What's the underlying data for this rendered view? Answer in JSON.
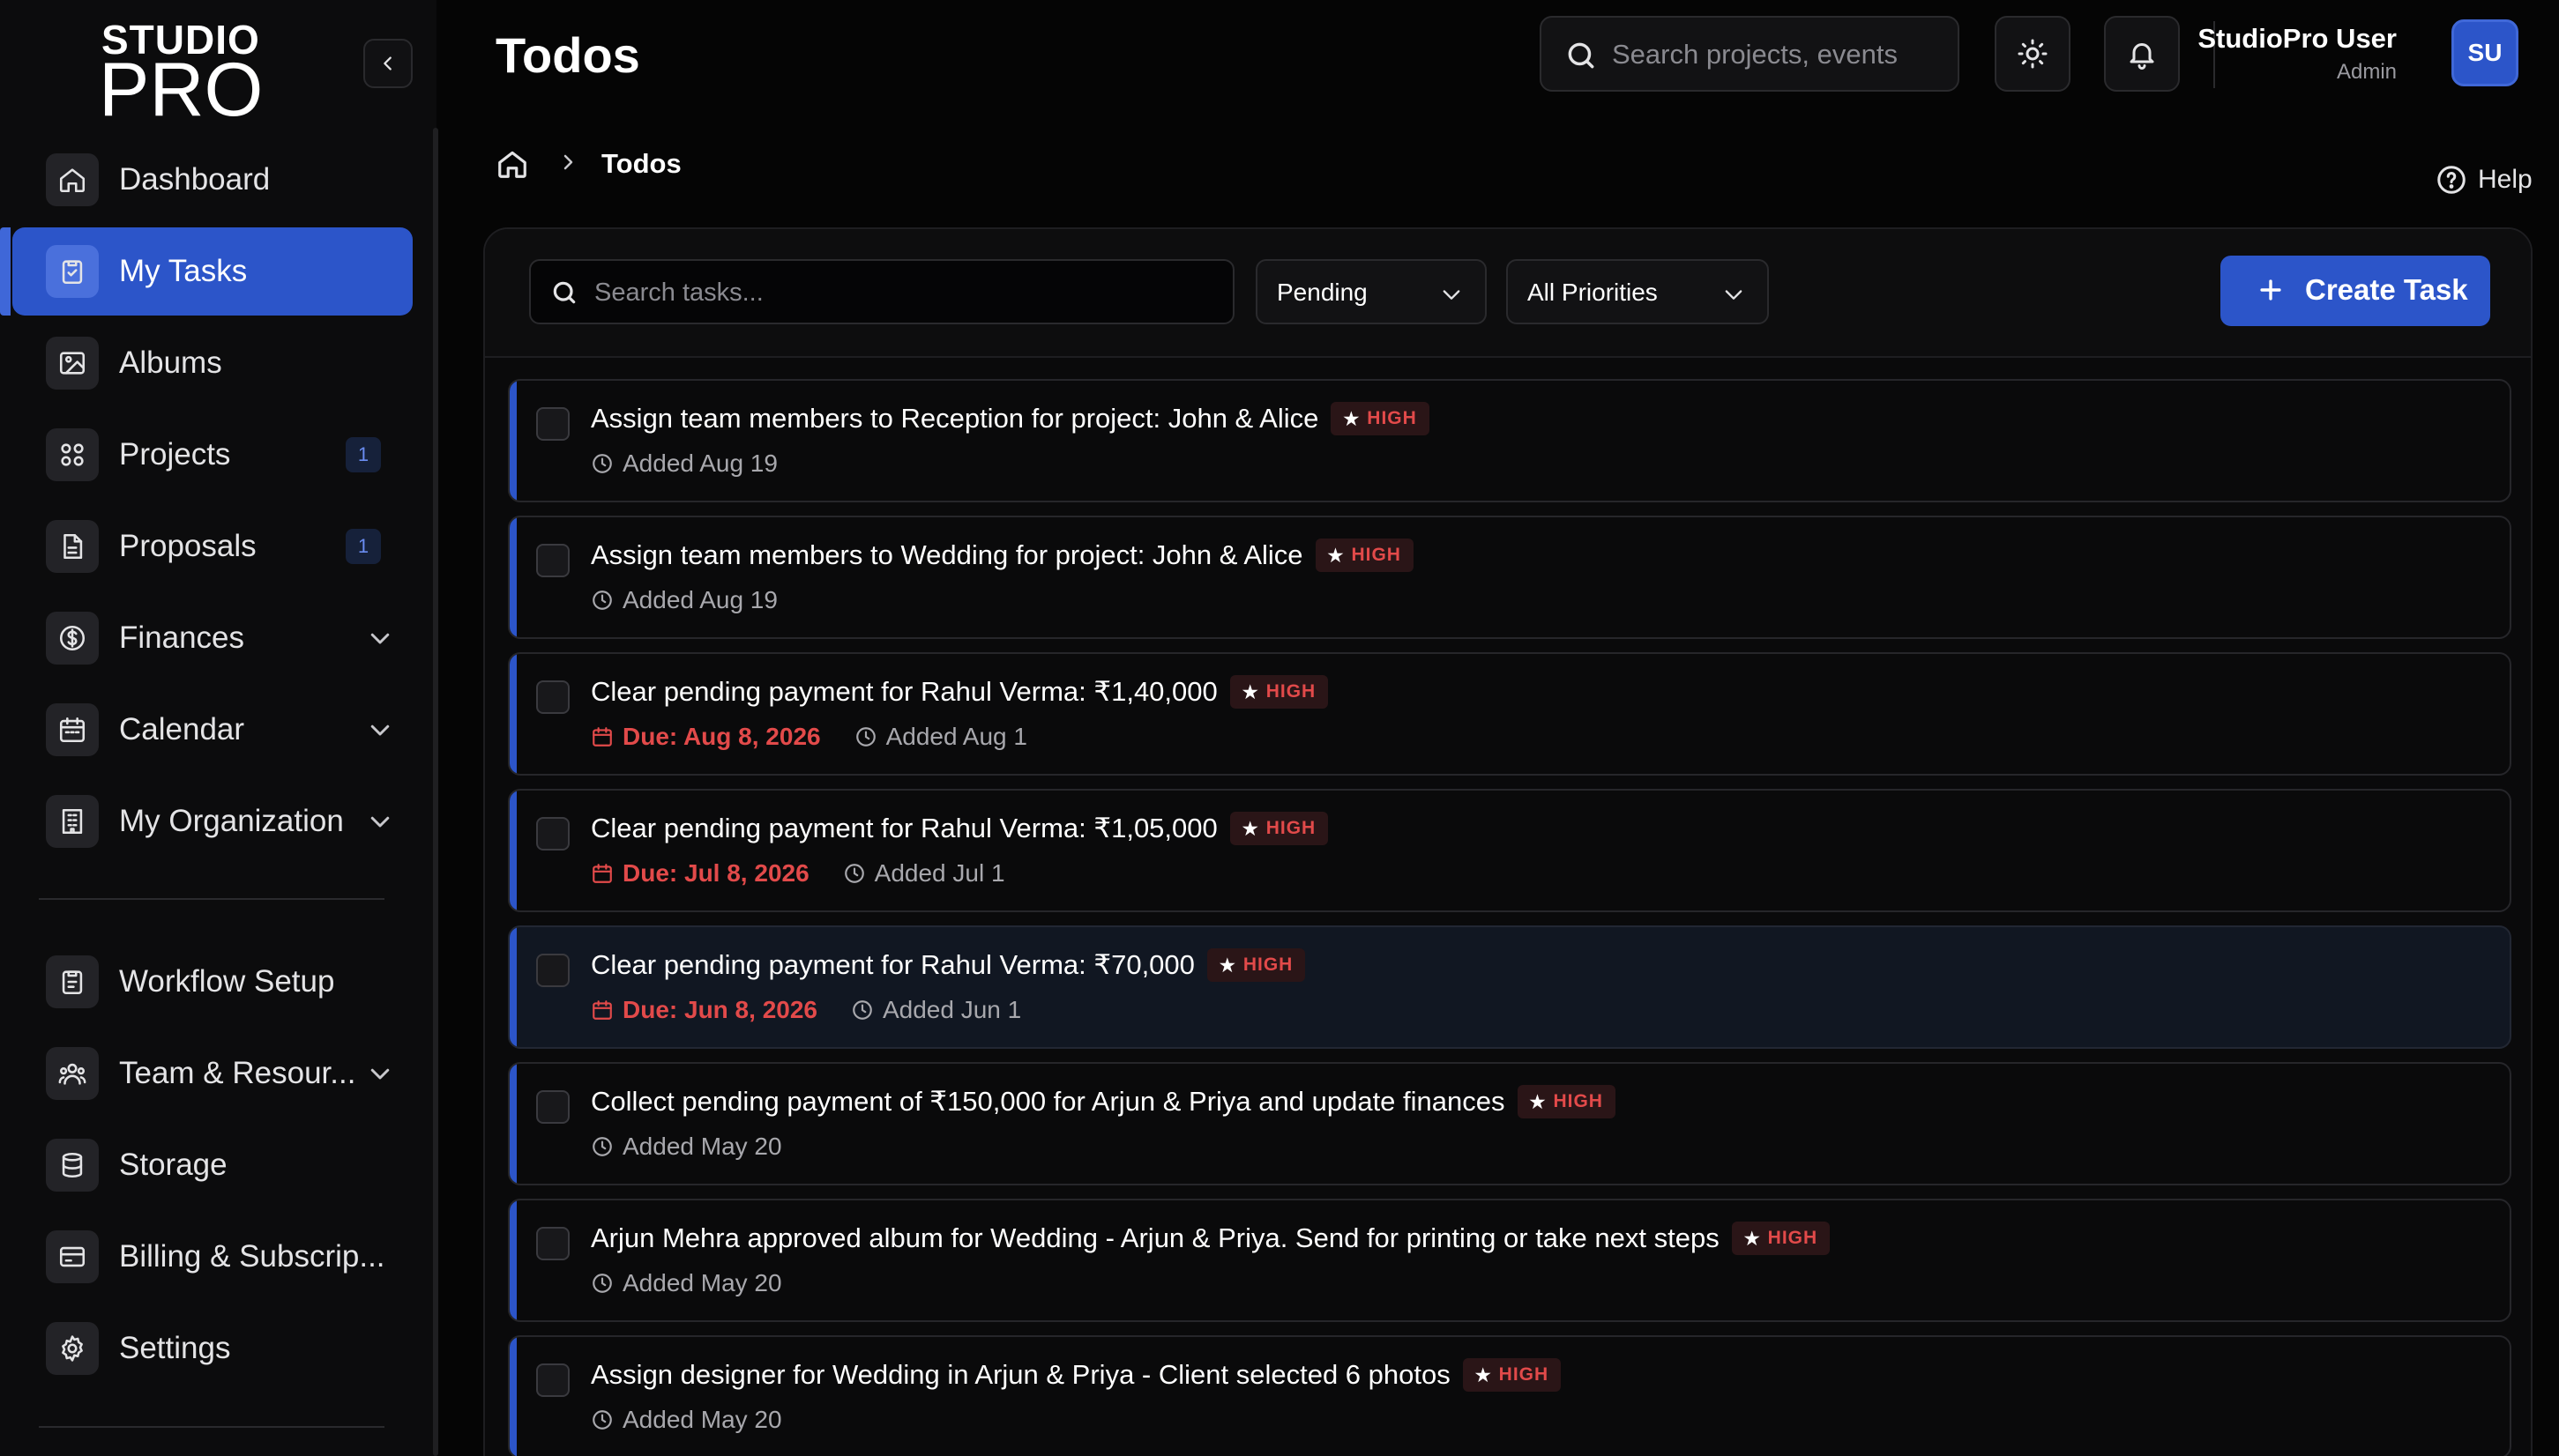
{
  "logo": {
    "top": "STUDIO",
    "bottom": "PRO"
  },
  "sidebar": {
    "items": [
      {
        "label": "Dashboard",
        "icon": "home-icon"
      },
      {
        "label": "My Tasks",
        "icon": "clipboard-check-icon",
        "active": true
      },
      {
        "label": "Albums",
        "icon": "image-icon"
      },
      {
        "label": "Projects",
        "icon": "grid-icon",
        "badge": "1"
      },
      {
        "label": "Proposals",
        "icon": "document-icon",
        "badge": "1"
      },
      {
        "label": "Finances",
        "icon": "dollar-icon",
        "expandable": true
      },
      {
        "label": "Calendar",
        "icon": "calendar-icon",
        "expandable": true
      },
      {
        "label": "My Organization",
        "icon": "building-icon",
        "expandable": true
      }
    ],
    "secondary_items": [
      {
        "label": "Workflow Setup",
        "icon": "clipboard-list-icon"
      },
      {
        "label": "Team & Resour...",
        "icon": "users-icon",
        "expandable": true
      },
      {
        "label": "Storage",
        "icon": "database-icon"
      },
      {
        "label": "Billing & Subscrip...",
        "icon": "credit-card-icon"
      },
      {
        "label": "Settings",
        "icon": "gear-icon"
      }
    ]
  },
  "header": {
    "title": "Todos",
    "search_placeholder": "Search projects, events",
    "user_name": "StudioPro User",
    "user_role": "Admin",
    "avatar_initials": "SU"
  },
  "breadcrumb": {
    "current": "Todos"
  },
  "help_label": "Help",
  "toolbar": {
    "search_placeholder": "Search tasks...",
    "status_filter": "Pending",
    "priority_filter": "All Priorities",
    "create_label": "Create Task"
  },
  "tasks": [
    {
      "title": "Assign team members to Reception for project: John & Alice",
      "priority": "HIGH",
      "due": "",
      "added": "Added Aug 19"
    },
    {
      "title": "Assign team members to Wedding for project: John & Alice",
      "priority": "HIGH",
      "due": "",
      "added": "Added Aug 19"
    },
    {
      "title": "Clear pending payment for Rahul Verma: ₹1,40,000",
      "priority": "HIGH",
      "due": "Due: Aug 8, 2026",
      "added": "Added Aug 1"
    },
    {
      "title": "Clear pending payment for Rahul Verma: ₹1,05,000",
      "priority": "HIGH",
      "due": "Due: Jul 8, 2026",
      "added": "Added Jul 1"
    },
    {
      "title": "Clear pending payment for Rahul Verma: ₹70,000",
      "priority": "HIGH",
      "due": "Due: Jun 8, 2026",
      "added": "Added Jun 1"
    },
    {
      "title": "Collect pending payment of ₹150,000 for Arjun & Priya and update finances",
      "priority": "HIGH",
      "due": "",
      "added": "Added May 20"
    },
    {
      "title": "Arjun Mehra approved album for Wedding - Arjun & Priya. Send for printing or take next steps",
      "priority": "HIGH",
      "due": "",
      "added": "Added May 20"
    },
    {
      "title": "Assign designer for Wedding in Arjun & Priya - Client selected 6 photos",
      "priority": "HIGH",
      "due": "",
      "added": "Added May 20"
    }
  ],
  "colors": {
    "accent": "#2c55c9",
    "danger": "#e24a4a",
    "background": "#050505"
  }
}
